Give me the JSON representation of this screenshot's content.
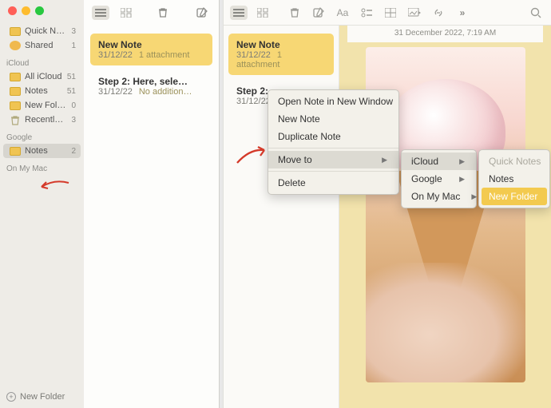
{
  "sidebar": {
    "top": [
      {
        "icon": "folder",
        "label": "Quick No…",
        "count": "3"
      },
      {
        "icon": "shared",
        "label": "Shared",
        "count": "1"
      }
    ],
    "sections": [
      {
        "title": "iCloud",
        "items": [
          {
            "label": "All iCloud",
            "count": "51"
          },
          {
            "label": "Notes",
            "count": "51"
          },
          {
            "label": "New Fol…",
            "count": "0"
          },
          {
            "label": "Recently…",
            "count": "3",
            "icon": "trash"
          }
        ]
      },
      {
        "title": "Google",
        "items": [
          {
            "label": "Notes",
            "count": "2",
            "selected": true
          }
        ]
      },
      {
        "title": "On My Mac",
        "items": []
      }
    ],
    "footer": "New Folder"
  },
  "notelist_left": [
    {
      "title": "New Note",
      "date": "31/12/22",
      "extra": "1 attachment",
      "selected": true
    },
    {
      "title": "Step 2: Here, sele…",
      "date": "31/12/22",
      "extra": "No addition…"
    }
  ],
  "editor": {
    "timestamp": "31 December 2022, 7:19 AM"
  },
  "notelist_right": [
    {
      "title": "New Note",
      "date": "31/12/22",
      "extra": "1 attachment",
      "selected": true
    },
    {
      "title": "Step 2:",
      "date": "31/12/22"
    }
  ],
  "context_menu": {
    "items": [
      {
        "label": "Open Note in New Window"
      },
      {
        "label": "New Note"
      },
      {
        "label": "Duplicate Note"
      },
      {
        "sep": true
      },
      {
        "label": "Move to",
        "submenu": true,
        "hover": true
      },
      {
        "sep": true
      },
      {
        "label": "Delete"
      }
    ],
    "sub1": [
      {
        "label": "iCloud",
        "submenu": true,
        "hover": true
      },
      {
        "label": "Google",
        "submenu": true
      },
      {
        "label": "On My Mac",
        "submenu": true
      }
    ],
    "sub2": [
      {
        "label": "Quick Notes",
        "disabled": true
      },
      {
        "label": "Notes"
      },
      {
        "label": "New Folder",
        "highlight": true
      }
    ]
  }
}
